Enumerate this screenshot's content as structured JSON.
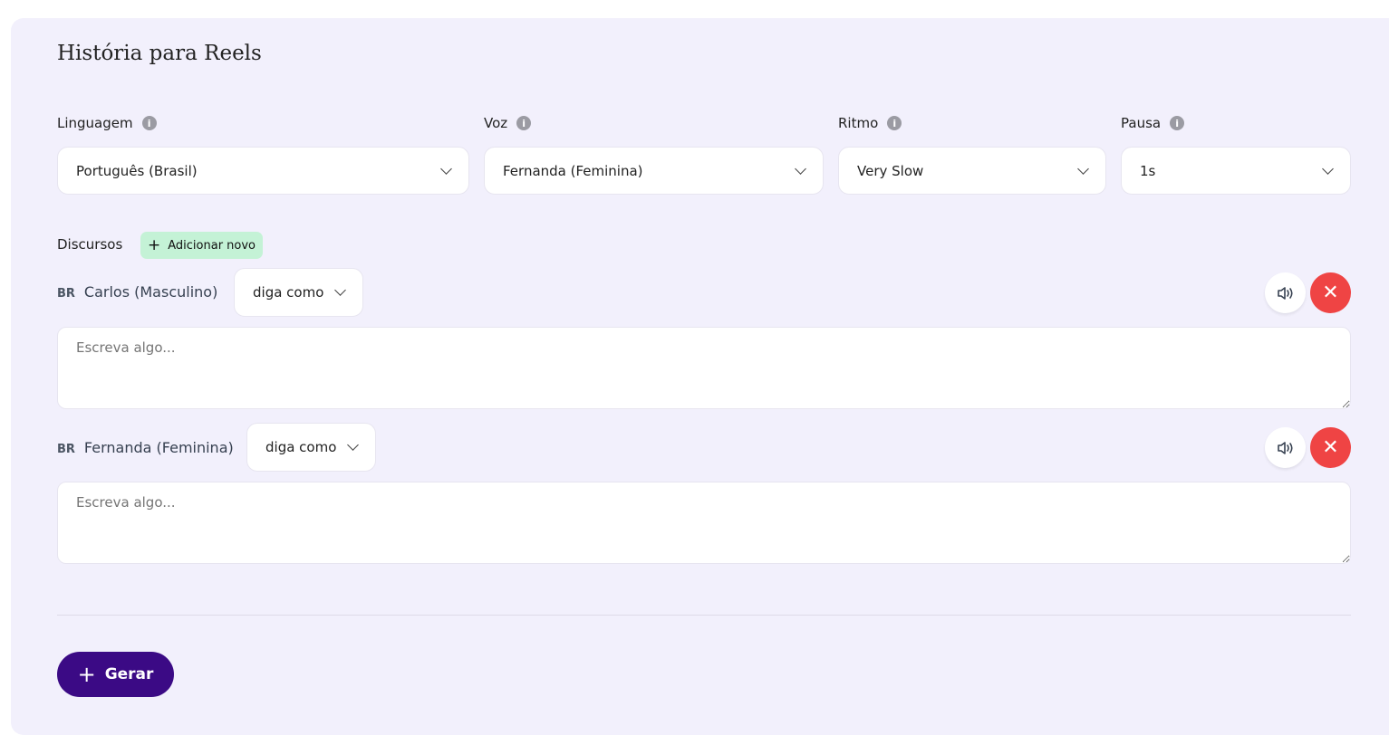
{
  "title": "História para Reels",
  "fields": [
    {
      "label": "Linguagem",
      "value": "Português (Brasil)"
    },
    {
      "label": "Voz",
      "value": "Fernanda (Feminina)"
    },
    {
      "label": "Ritmo",
      "value": "Very Slow"
    },
    {
      "label": "Pausa",
      "value": "1s"
    }
  ],
  "speeches": {
    "label": "Discursos",
    "add_label": "Adicionar novo",
    "items": [
      {
        "flag": "BR",
        "voice": "Carlos (Masculino)",
        "style": "diga como",
        "placeholder": "Escreva algo..."
      },
      {
        "flag": "BR",
        "voice": "Fernanda (Feminina)",
        "style": "diga como",
        "placeholder": "Escreva algo..."
      }
    ]
  },
  "generate_label": "Gerar",
  "colors": {
    "background": "#f2f0fc",
    "accent": "#3b0a85",
    "add": "#c4f2d6",
    "delete": "#ef4444"
  }
}
